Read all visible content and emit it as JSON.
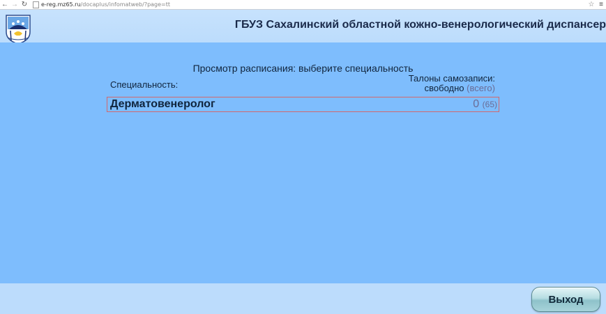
{
  "browser": {
    "url_host": "e-reg.mz65.ru",
    "url_path": "/docaplus/infomatweb/?page=tt"
  },
  "header": {
    "title": "ГБУЗ Сахалинский областной кожно-венерологический диспансер"
  },
  "main": {
    "title": "Просмотр расписания: выберите специальность",
    "column_specialty": "Специальность:",
    "column_tickets_line1": "Талоны самозаписи:",
    "column_tickets_free": "свободно",
    "column_tickets_total": "(всего)",
    "rows": [
      {
        "name": "Дерматовенеролог",
        "free": "0",
        "total": "(65)"
      }
    ]
  },
  "footer": {
    "exit_label": "Выход"
  },
  "colors": {
    "background": "#7ebdfd",
    "header": "#bcdcfc",
    "row_border": "#d2686c",
    "muted_text": "#6a6c96"
  }
}
